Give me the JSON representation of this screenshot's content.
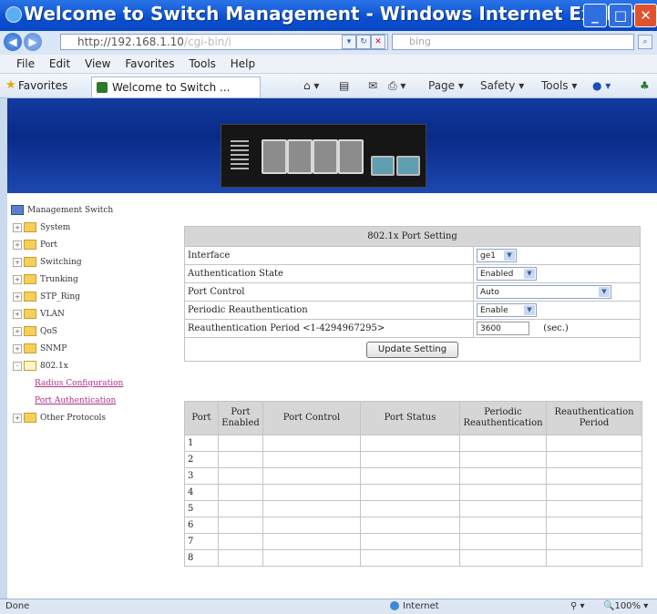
{
  "window": {
    "title": "Welcome to Switch Management - Windows Internet Explorer"
  },
  "address_bar": {
    "url": "http://192.168.1.10",
    "url_path": "/cgi-bin/i",
    "search_placeholder": "bing"
  },
  "menu": [
    "File",
    "Edit",
    "View",
    "Favorites",
    "Tools",
    "Help"
  ],
  "favorites_bar": {
    "favorites_label": "Favorites",
    "tab_title": "Welcome to Switch ...",
    "commands": [
      "Page",
      "Safety",
      "Tools"
    ]
  },
  "sidebar": {
    "root": "Management Switch",
    "items": [
      {
        "label": "System",
        "expander": "+"
      },
      {
        "label": "Port",
        "expander": "+"
      },
      {
        "label": "Switching",
        "expander": "+"
      },
      {
        "label": "Trunking",
        "expander": "+"
      },
      {
        "label": "STP_Ring",
        "expander": "+"
      },
      {
        "label": "VLAN",
        "expander": "+"
      },
      {
        "label": "QoS",
        "expander": "+"
      },
      {
        "label": "SNMP",
        "expander": "+"
      },
      {
        "label": "802.1x",
        "expander": "-"
      }
    ],
    "children": [
      "Radius Configuration",
      "Port Authentication"
    ],
    "last": {
      "label": "Other Protocols",
      "expander": "+"
    }
  },
  "port_setting": {
    "title": "802.1x Port Setting",
    "rows": [
      {
        "label": "Interface",
        "value": "ge1",
        "kind": "select",
        "width": "s"
      },
      {
        "label": "Authentication State",
        "value": "Enabled",
        "kind": "select",
        "width": "m"
      },
      {
        "label": "Port Control",
        "value": "Auto",
        "kind": "select",
        "width": "l"
      },
      {
        "label": "Periodic Reauthentication",
        "value": "Enable",
        "kind": "select",
        "width": "m"
      }
    ],
    "reauth_label": "Reauthentication Period <1-4294967295>",
    "reauth_value": "3600",
    "reauth_unit": "(sec.)",
    "update_button": "Update Setting"
  },
  "status_table": {
    "headers": [
      "Port",
      "Port Enabled",
      "Port Control",
      "Port Status",
      "Periodic Reauthentication",
      "Reauthentication Period"
    ],
    "ports": [
      "1",
      "2",
      "3",
      "4",
      "5",
      "6",
      "7",
      "8"
    ]
  },
  "statusbar": {
    "left": "Done",
    "zone": "Internet",
    "zoom": "100%"
  }
}
